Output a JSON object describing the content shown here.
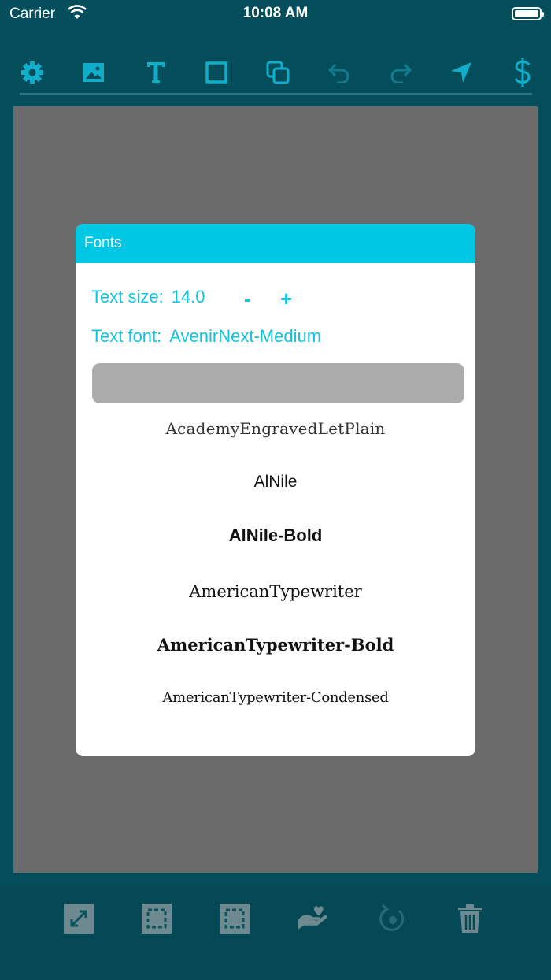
{
  "status_bar": {
    "carrier": "Carrier",
    "time": "10:08 AM"
  },
  "toolbar": {
    "icons": [
      "gear-icon",
      "image-icon",
      "text-icon",
      "square-icon",
      "copy-icon",
      "undo-icon",
      "redo-icon",
      "send-icon",
      "dollar-icon"
    ]
  },
  "dialog": {
    "title": "Fonts",
    "text_size_label": "Text size:",
    "text_size_value": "14.0",
    "minus_label": "-",
    "plus_label": "+",
    "text_font_label": "Text font:",
    "text_font_value": "AvenirNext-Medium",
    "search_placeholder": "",
    "fonts": [
      "AcademyEngravedLetPlain",
      "AlNile",
      "AlNile-Bold",
      "AmericanTypewriter",
      "AmericanTypewriter-Bold",
      "AmericanTypewriter-Condensed"
    ]
  },
  "bottom_bar": {
    "icons": [
      "resize-icon",
      "select-box-icon",
      "select-box-alt-icon",
      "hand-heart-icon",
      "rotate-icon",
      "trash-icon"
    ]
  },
  "colors": {
    "background": "#034e5a",
    "accent": "#00c8e4",
    "canvas": "#6b6b6b"
  }
}
